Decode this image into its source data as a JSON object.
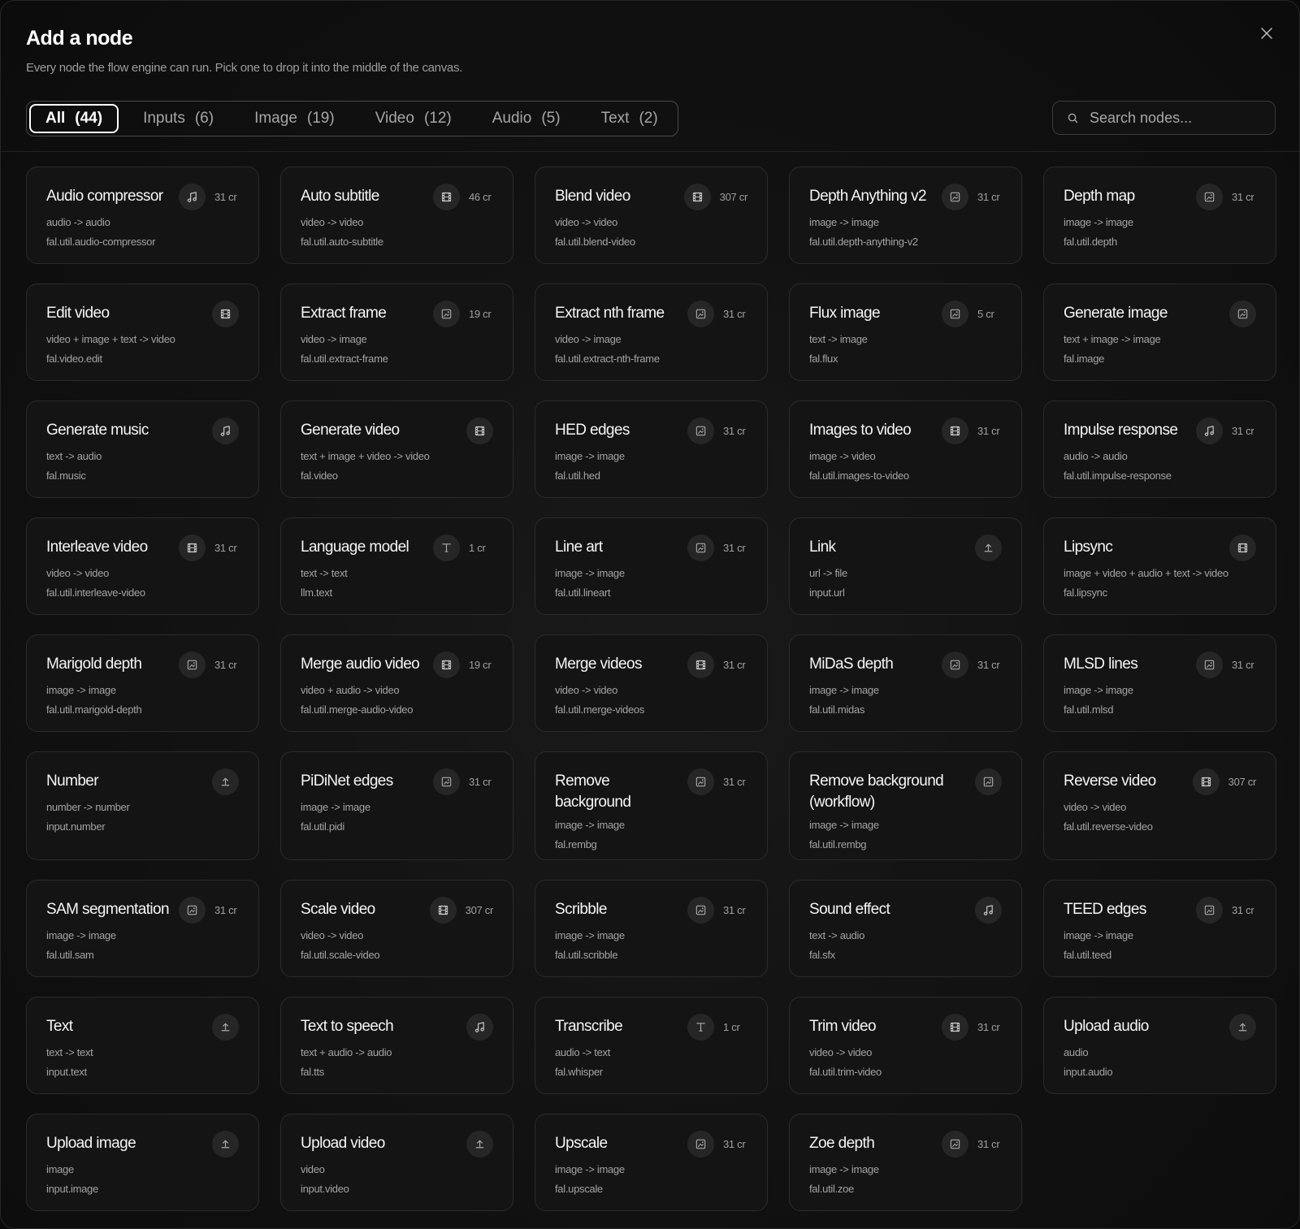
{
  "dialog": {
    "title": "Add a node",
    "subtitle": "Every node the flow engine can run. Pick one to drop it into the middle of the canvas."
  },
  "tabs": [
    {
      "label": "All",
      "count": "(44)",
      "active": true
    },
    {
      "label": "Inputs",
      "count": "(6)"
    },
    {
      "label": "Image",
      "count": "(19)"
    },
    {
      "label": "Video",
      "count": "(12)"
    },
    {
      "label": "Audio",
      "count": "(5)"
    },
    {
      "label": "Text",
      "count": "(2)"
    }
  ],
  "search": {
    "placeholder": "Search nodes..."
  },
  "nodes": [
    {
      "title": "Audio compressor",
      "icon": "audio",
      "cost": "31 cr",
      "io": "audio -> audio",
      "slug": "fal.util.audio-compressor"
    },
    {
      "title": "Auto subtitle",
      "icon": "video",
      "cost": "46 cr",
      "io": "video -> video",
      "slug": "fal.util.auto-subtitle"
    },
    {
      "title": "Blend video",
      "icon": "video",
      "cost": "307 cr",
      "io": "video -> video",
      "slug": "fal.util.blend-video"
    },
    {
      "title": "Depth Anything v2",
      "icon": "image",
      "cost": "31 cr",
      "io": "image -> image",
      "slug": "fal.util.depth-anything-v2"
    },
    {
      "title": "Depth map",
      "icon": "image",
      "cost": "31 cr",
      "io": "image -> image",
      "slug": "fal.util.depth"
    },
    {
      "title": "Edit video",
      "icon": "video",
      "cost": "",
      "io": "video + image + text -> video",
      "slug": "fal.video.edit"
    },
    {
      "title": "Extract frame",
      "icon": "image",
      "cost": "19 cr",
      "io": "video -> image",
      "slug": "fal.util.extract-frame"
    },
    {
      "title": "Extract nth frame",
      "icon": "image",
      "cost": "31 cr",
      "io": "video -> image",
      "slug": "fal.util.extract-nth-frame"
    },
    {
      "title": "Flux image",
      "icon": "image",
      "cost": "5 cr",
      "io": "text -> image",
      "slug": "fal.flux"
    },
    {
      "title": "Generate image",
      "icon": "image",
      "cost": "",
      "io": "text + image -> image",
      "slug": "fal.image"
    },
    {
      "title": "Generate music",
      "icon": "audio",
      "cost": "",
      "io": "text -> audio",
      "slug": "fal.music"
    },
    {
      "title": "Generate video",
      "icon": "video",
      "cost": "",
      "io": "text + image + video -> video",
      "slug": "fal.video"
    },
    {
      "title": "HED edges",
      "icon": "image",
      "cost": "31 cr",
      "io": "image -> image",
      "slug": "fal.util.hed"
    },
    {
      "title": "Images to video",
      "icon": "video",
      "cost": "31 cr",
      "io": "image -> video",
      "slug": "fal.util.images-to-video"
    },
    {
      "title": "Impulse response",
      "icon": "audio",
      "cost": "31 cr",
      "io": "audio -> audio",
      "slug": "fal.util.impulse-response"
    },
    {
      "title": "Interleave video",
      "icon": "video",
      "cost": "31 cr",
      "io": "video -> video",
      "slug": "fal.util.interleave-video"
    },
    {
      "title": "Language model",
      "icon": "text",
      "cost": "1 cr",
      "io": "text -> text",
      "slug": "llm.text"
    },
    {
      "title": "Line art",
      "icon": "image",
      "cost": "31 cr",
      "io": "image -> image",
      "slug": "fal.util.lineart"
    },
    {
      "title": "Link",
      "icon": "upload",
      "cost": "",
      "io": "url -> file",
      "slug": "input.url"
    },
    {
      "title": "Lipsync",
      "icon": "video",
      "cost": "",
      "io": "image + video + audio + text -> video",
      "slug": "fal.lipsync"
    },
    {
      "title": "Marigold depth",
      "icon": "image",
      "cost": "31 cr",
      "io": "image -> image",
      "slug": "fal.util.marigold-depth"
    },
    {
      "title": "Merge audio video",
      "icon": "video",
      "cost": "19 cr",
      "io": "video + audio -> video",
      "slug": "fal.util.merge-audio-video"
    },
    {
      "title": "Merge videos",
      "icon": "video",
      "cost": "31 cr",
      "io": "video -> video",
      "slug": "fal.util.merge-videos"
    },
    {
      "title": "MiDaS depth",
      "icon": "image",
      "cost": "31 cr",
      "io": "image -> image",
      "slug": "fal.util.midas"
    },
    {
      "title": "MLSD lines",
      "icon": "image",
      "cost": "31 cr",
      "io": "image -> image",
      "slug": "fal.util.mlsd"
    },
    {
      "title": "Number",
      "icon": "upload",
      "cost": "",
      "io": "number -> number",
      "slug": "input.number"
    },
    {
      "title": "PiDiNet edges",
      "icon": "image",
      "cost": "31 cr",
      "io": "image -> image",
      "slug": "fal.util.pidi"
    },
    {
      "title": "Remove background",
      "icon": "image",
      "cost": "31 cr",
      "io": "image -> image",
      "slug": "fal.rembg"
    },
    {
      "title": "Remove background (workflow)",
      "icon": "image",
      "cost": "",
      "io": "image -> image",
      "slug": "fal.util.rembg"
    },
    {
      "title": "Reverse video",
      "icon": "video",
      "cost": "307 cr",
      "io": "video -> video",
      "slug": "fal.util.reverse-video"
    },
    {
      "title": "SAM segmentation",
      "icon": "image",
      "cost": "31 cr",
      "io": "image -> image",
      "slug": "fal.util.sam"
    },
    {
      "title": "Scale video",
      "icon": "video",
      "cost": "307 cr",
      "io": "video -> video",
      "slug": "fal.util.scale-video"
    },
    {
      "title": "Scribble",
      "icon": "image",
      "cost": "31 cr",
      "io": "image -> image",
      "slug": "fal.util.scribble"
    },
    {
      "title": "Sound effect",
      "icon": "audio",
      "cost": "",
      "io": "text -> audio",
      "slug": "fal.sfx"
    },
    {
      "title": "TEED edges",
      "icon": "image",
      "cost": "31 cr",
      "io": "image -> image",
      "slug": "fal.util.teed"
    },
    {
      "title": "Text",
      "icon": "upload",
      "cost": "",
      "io": "text -> text",
      "slug": "input.text"
    },
    {
      "title": "Text to speech",
      "icon": "audio",
      "cost": "",
      "io": "text + audio -> audio",
      "slug": "fal.tts"
    },
    {
      "title": "Transcribe",
      "icon": "text",
      "cost": "1 cr",
      "io": "audio -> text",
      "slug": "fal.whisper"
    },
    {
      "title": "Trim video",
      "icon": "video",
      "cost": "31 cr",
      "io": "video -> video",
      "slug": "fal.util.trim-video"
    },
    {
      "title": "Upload audio",
      "icon": "upload",
      "cost": "",
      "io": "audio",
      "slug": "input.audio"
    },
    {
      "title": "Upload image",
      "icon": "upload",
      "cost": "",
      "io": "image",
      "slug": "input.image"
    },
    {
      "title": "Upload video",
      "icon": "upload",
      "cost": "",
      "io": "video",
      "slug": "input.video"
    },
    {
      "title": "Upscale",
      "icon": "image",
      "cost": "31 cr",
      "io": "image -> image",
      "slug": "fal.upscale"
    },
    {
      "title": "Zoe depth",
      "icon": "image",
      "cost": "31 cr",
      "io": "image -> image",
      "slug": "fal.util.zoe"
    }
  ]
}
